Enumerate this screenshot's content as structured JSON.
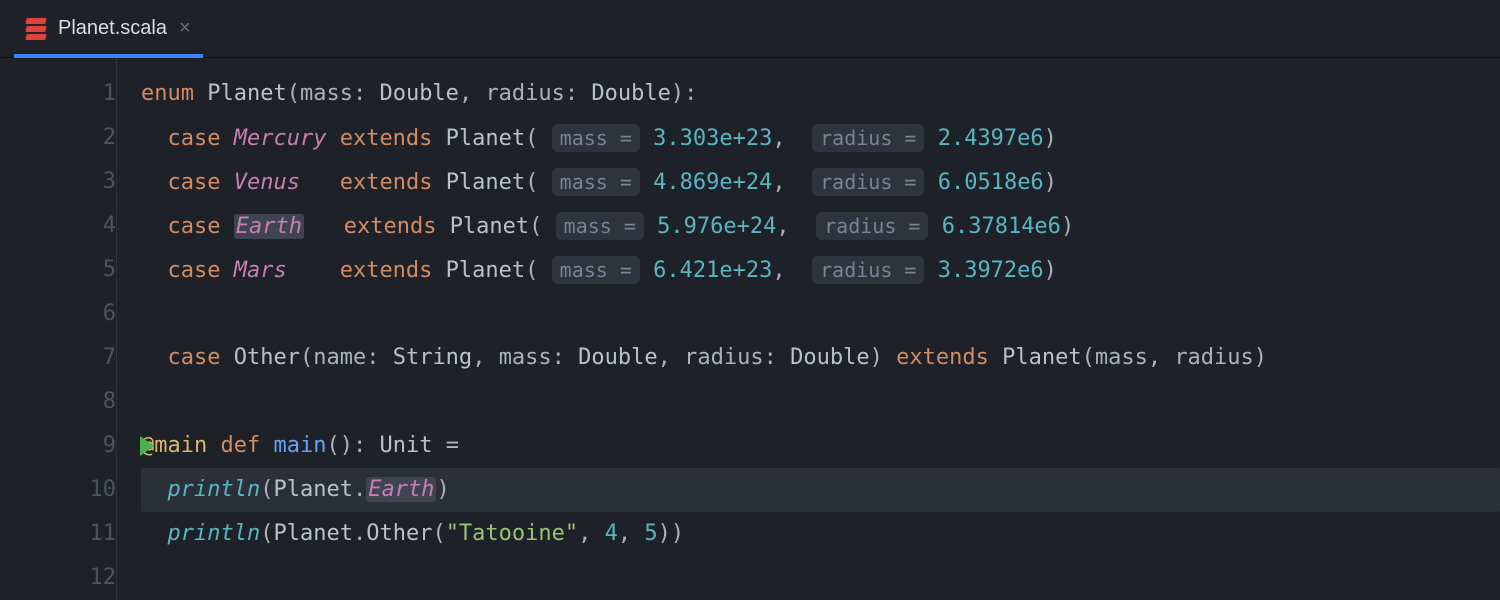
{
  "tab": {
    "title": "Planet.scala",
    "close": "×"
  },
  "lines": [
    "1",
    "2",
    "3",
    "4",
    "5",
    "6",
    "7",
    "8",
    "9",
    "10",
    "11",
    "12"
  ],
  "kw": {
    "enum": "enum",
    "case": "case",
    "extends": "extends",
    "def": "def"
  },
  "common": {
    "planet": "Planet",
    "open": "(",
    "close": ")",
    "colon": ":",
    "comma": ",",
    "mass": "mass",
    "radius": "radius",
    "name": "name",
    "string": "String",
    "double": "Double",
    "unit": "Unit",
    "eq": "=",
    "dot": ".",
    "println": "println"
  },
  "hint": {
    "mass": "mass =",
    "radius": "radius ="
  },
  "ann": {
    "main": "@main"
  },
  "fn": {
    "main": "main"
  },
  "cases": {
    "mercury": {
      "name": "Mercury",
      "mass": "3.303e+23",
      "radius": "2.4397e6"
    },
    "venus": {
      "name": "Venus",
      "mass": "4.869e+24",
      "radius": "6.0518e6"
    },
    "earth": {
      "name": "Earth",
      "mass": "5.976e+24",
      "radius": "6.37814e6"
    },
    "mars": {
      "name": "Mars",
      "mass": "6.421e+23",
      "radius": "3.3972e6"
    }
  },
  "other": {
    "name": "Other"
  },
  "str": {
    "tatooine": "\"Tatooine\""
  },
  "nums": {
    "four": "4",
    "five": "5"
  }
}
